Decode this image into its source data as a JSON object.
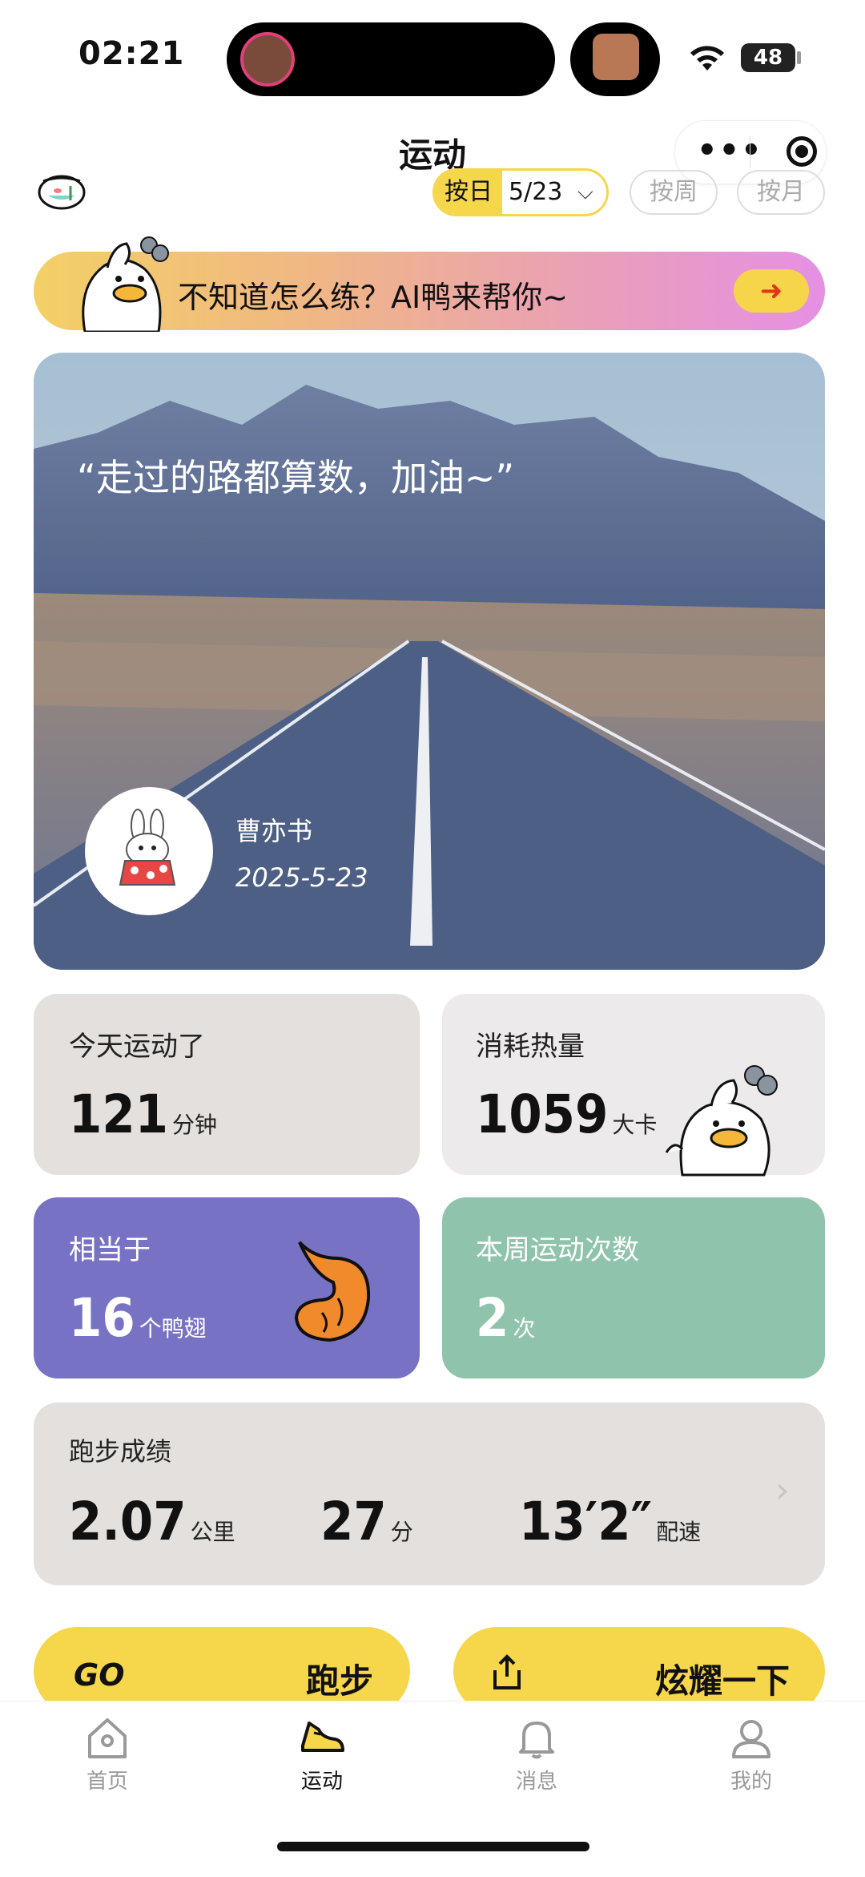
{
  "status_bar": {
    "time": "02:21",
    "battery": "48"
  },
  "header": {
    "title": "运动",
    "capsule_more_icon": "more-dots-icon",
    "capsule_close_icon": "target-icon"
  },
  "date_filter": {
    "by_day_label": "按日",
    "selected_date": "5/23",
    "by_week_label": "按周",
    "by_month_label": "按月"
  },
  "ai_banner": {
    "text": "不知道怎么练？AI鸭来帮你~",
    "arrow_icon": "arrow-right-icon"
  },
  "hero": {
    "quote": "“走过的路都算数，加油~”",
    "user_name": "曹亦书",
    "date": "2025-5-23"
  },
  "stats": {
    "today": {
      "label": "今天运动了",
      "value": "121",
      "unit": "分钟"
    },
    "calories": {
      "label": "消耗热量",
      "value": "1059",
      "unit": "大卡"
    },
    "equivalent": {
      "label": "相当于",
      "value": "16",
      "unit": "个鸭翅"
    },
    "weekly": {
      "label": "本周运动次数",
      "value": "2",
      "unit": "次"
    }
  },
  "running": {
    "label": "跑步成绩",
    "distance": "2.07",
    "distance_unit": "公里",
    "duration": "27",
    "duration_unit": "分",
    "pace": "13′2″",
    "pace_unit": "配速"
  },
  "actions": {
    "run_logo": "GO",
    "run_label": "跑步",
    "share_label": "炫耀一下"
  },
  "tabs": [
    {
      "label": "首页",
      "icon": "home-icon"
    },
    {
      "label": "运动",
      "icon": "sneaker-icon"
    },
    {
      "label": "消息",
      "icon": "bell-icon"
    },
    {
      "label": "我的",
      "icon": "user-icon"
    }
  ],
  "colors": {
    "accent_yellow": "#f6d64a",
    "purple_card": "#7872c4",
    "green_card": "#90c3ac",
    "grey_card": "#e3e0dd"
  }
}
